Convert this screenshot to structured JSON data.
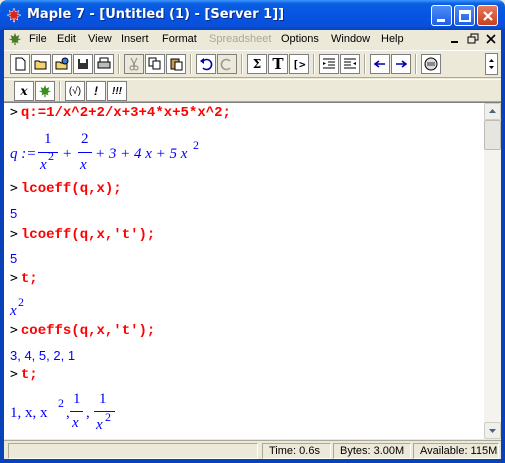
{
  "window": {
    "title": "Maple 7  - [Untitled (1) - [Server 1]]"
  },
  "menu": {
    "items": [
      "File",
      "Edit",
      "View",
      "Insert",
      "Format",
      "Spreadsheet",
      "Options",
      "Window",
      "Help"
    ]
  },
  "toolbar": {
    "sigma_label": "Σ",
    "text_label": "T",
    "input_label": "[>",
    "eval_label": "x",
    "maple_label": "✤",
    "check_label": "(√)",
    "bang_label": "!",
    "bang3_label": "!!!"
  },
  "worksheet": {
    "prompt": ">",
    "cmd1": "q:=1/x^2+2/x+3+4*x+5*x^2;",
    "out1": {
      "lhs": "q :=",
      "num1": "1",
      "den1": "x",
      "den1_exp": "2",
      "plus1": "+",
      "num2": "2",
      "den2": "x",
      "rest": "+ 3 + 4 x + 5 x",
      "rest_exp": "2"
    },
    "cmd2": "lcoeff(q,x);",
    "out2": "5",
    "cmd3": "lcoeff(q,x,'t');",
    "out3": "5",
    "cmd4": "t;",
    "out4_base": "x",
    "out4_exp": "2",
    "cmd5": "coeffs(q,x,'t');",
    "out5": "3, 4, 5, 2, 1",
    "cmd6": "t;",
    "out6": {
      "prefix": "1, x, x",
      "exp": "2",
      "comma": ",",
      "num1": "1",
      "den1": "x",
      "comma2": ",",
      "num2": "1",
      "den2": "x",
      "den2_exp": "2"
    }
  },
  "status": {
    "time": "Time:  0.6s",
    "bytes": "Bytes: 3.00M",
    "available": "Available: 115M"
  },
  "colors": {
    "input": "#ff0000",
    "output": "#0000ff",
    "titlebar": "#0554e3"
  }
}
